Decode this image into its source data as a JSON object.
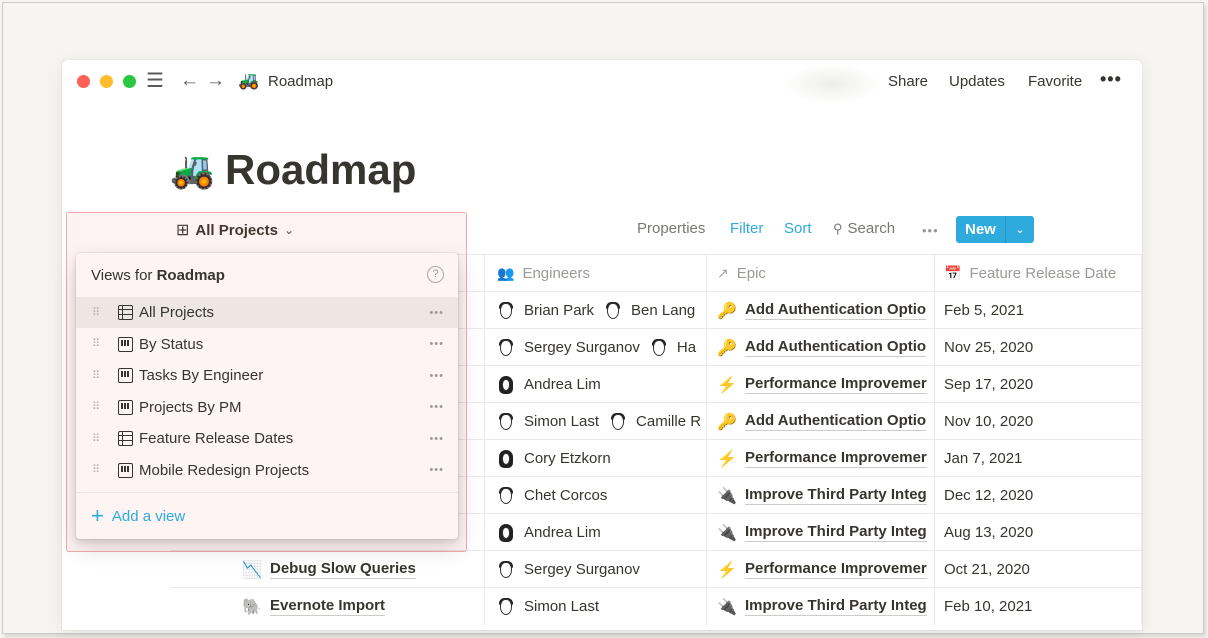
{
  "window": {
    "title": "Roadmap",
    "title_emoji": "🚜",
    "actions": {
      "share": "Share",
      "updates": "Updates",
      "favorite": "Favorite",
      "more": "•••"
    },
    "nav": {
      "menu_icon": "☰",
      "back_icon": "←",
      "forward_icon": "→"
    }
  },
  "page": {
    "emoji": "🚜",
    "title": "Roadmap"
  },
  "view_bar": {
    "current_view": "All Projects",
    "view_icon": "⊞",
    "chevron": "⌄",
    "properties": "Properties",
    "filter": "Filter",
    "sort": "Sort",
    "search": "Search",
    "search_icon": "🔍",
    "more": "•••",
    "new_label": "New",
    "new_chevron": "⌄"
  },
  "views_popup": {
    "header_prefix": "Views for ",
    "header_bold": "Roadmap",
    "help_icon": "?",
    "items": [
      {
        "label": "All Projects",
        "icon": "table",
        "active": true
      },
      {
        "label": "By Status",
        "icon": "board",
        "active": false
      },
      {
        "label": "Tasks By Engineer",
        "icon": "board",
        "active": false
      },
      {
        "label": "Projects By PM",
        "icon": "board",
        "active": false
      },
      {
        "label": "Feature Release Dates",
        "icon": "table",
        "active": false
      },
      {
        "label": "Mobile Redesign Projects",
        "icon": "board",
        "active": false
      }
    ],
    "item_more": "•••",
    "grip": "⠿",
    "add_view": "Add a view",
    "add_icon": "+"
  },
  "table": {
    "columns": [
      {
        "label": "Engineers",
        "icon": "people-icon",
        "glyph": "👥"
      },
      {
        "label": "Epic",
        "icon": "relation-arrow-icon",
        "glyph": "↗"
      },
      {
        "label": "Feature Release Date",
        "icon": "calendar-icon",
        "glyph": "📅"
      }
    ],
    "rows": [
      {
        "name": "",
        "name_icon": "",
        "engineers": [
          "Brian Park",
          "Ben Lang"
        ],
        "epic": "Add Authentication Optio",
        "epic_icon": "🔑",
        "date": "Feb 5, 2021"
      },
      {
        "name": "",
        "name_icon": "",
        "engineers": [
          "Sergey Surganov",
          "Ha"
        ],
        "epic": "Add Authentication Optio",
        "epic_icon": "🔑",
        "date": "Nov 25, 2020"
      },
      {
        "name": "",
        "name_icon": "",
        "engineers": [
          "Andrea Lim"
        ],
        "epic": "Performance Improvemer",
        "epic_icon": "⚡",
        "date": "Sep 17, 2020"
      },
      {
        "name": "",
        "name_icon": "",
        "engineers": [
          "Simon Last",
          "Camille R"
        ],
        "epic": "Add Authentication Optio",
        "epic_icon": "🔑",
        "date": "Nov 10, 2020"
      },
      {
        "name": "",
        "name_icon": "",
        "engineers": [
          "Cory Etzkorn"
        ],
        "epic": "Performance Improvemer",
        "epic_icon": "⚡",
        "date": "Jan 7, 2021"
      },
      {
        "name": "",
        "name_icon": "",
        "engineers": [
          "Chet Corcos"
        ],
        "epic": "Improve Third Party Integ",
        "epic_icon": "🔌",
        "date": "Dec 12, 2020"
      },
      {
        "name": "",
        "name_icon": "",
        "engineers": [
          "Andrea Lim"
        ],
        "epic": "Improve Third Party Integ",
        "epic_icon": "🔌",
        "date": "Aug 13, 2020"
      },
      {
        "name": "Debug Slow Queries",
        "name_icon": "📉",
        "engineers": [
          "Sergey Surganov"
        ],
        "epic": "Performance Improvemer",
        "epic_icon": "⚡",
        "date": "Oct 21, 2020"
      },
      {
        "name": "Evernote Import",
        "name_icon": "🐘",
        "engineers": [
          "Simon Last"
        ],
        "epic": "Improve Third Party Integ",
        "epic_icon": "🔌",
        "date": "Feb 10, 2021"
      }
    ]
  },
  "colors": {
    "accent": "#2eaadc",
    "text": "#37352f",
    "muted": "#9b9a97",
    "highlight_border": "#f0a9a9",
    "popup_bg": "#fdf4f3"
  }
}
